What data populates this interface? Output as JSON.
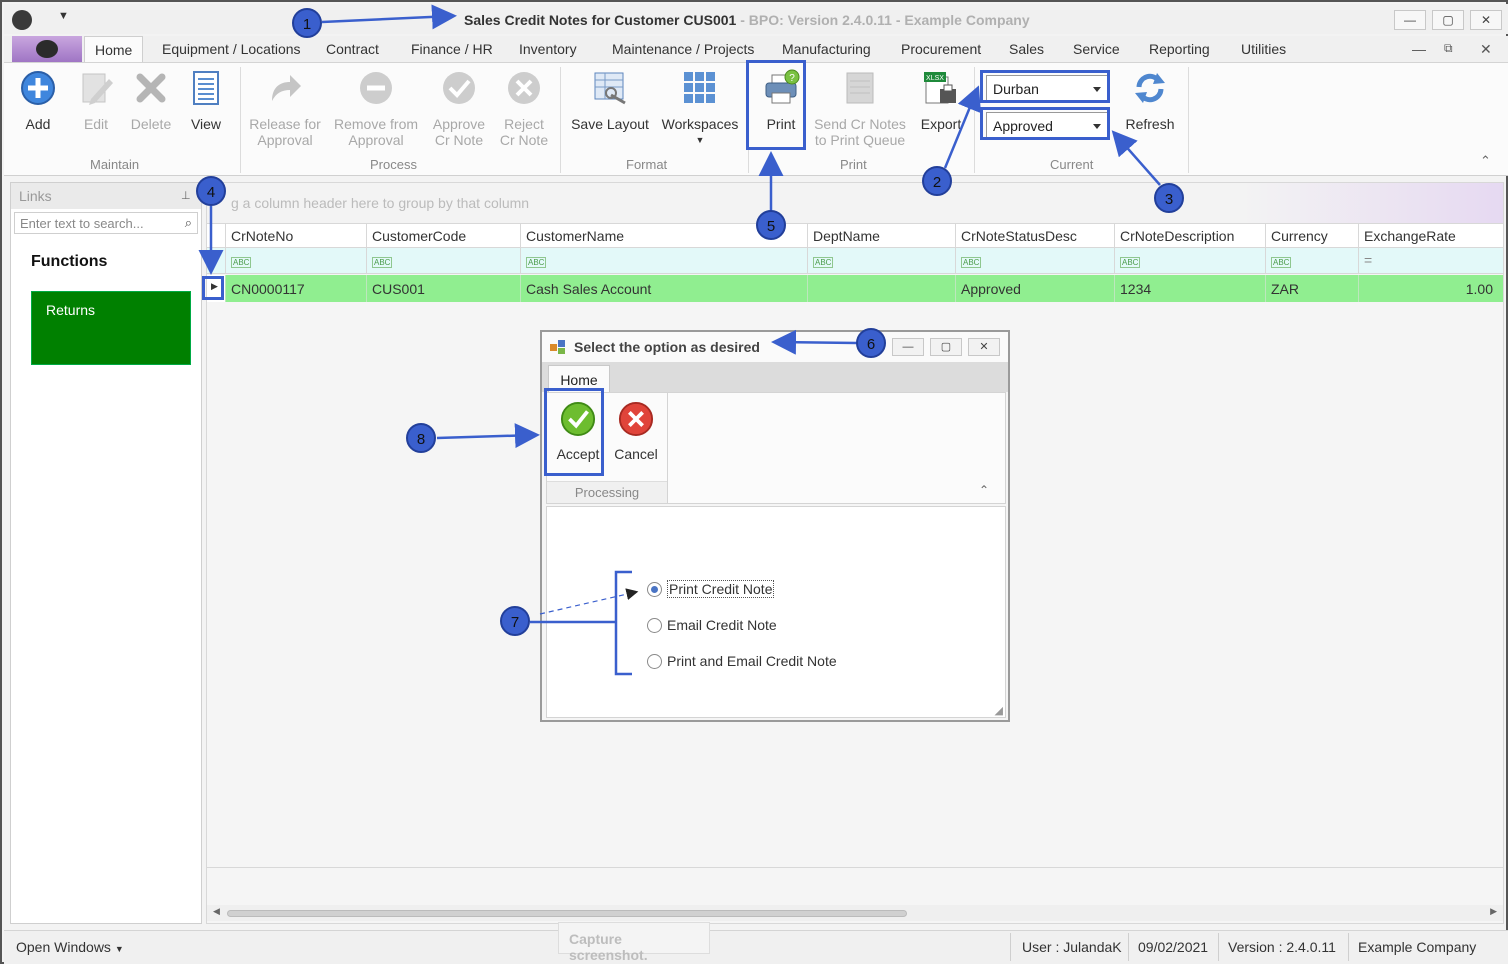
{
  "window": {
    "title": "Sales Credit Notes for Customer CUS001",
    "subtitle": "- BPO: Version 2.4.0.11 - Example Company"
  },
  "tabs": [
    "Home",
    "Equipment / Locations",
    "Contract",
    "Finance / HR",
    "Inventory",
    "Maintenance / Projects",
    "Manufacturing",
    "Procurement",
    "Sales",
    "Service",
    "Reporting",
    "Utilities"
  ],
  "ribbon": {
    "maintain": {
      "label": "Maintain",
      "add": "Add",
      "edit": "Edit",
      "delete": "Delete",
      "view": "View"
    },
    "process": {
      "label": "Process",
      "release_l1": "Release for",
      "release_l2": "Approval",
      "remove_l1": "Remove from",
      "remove_l2": "Approval",
      "approve_l1": "Approve",
      "approve_l2": "Cr Note",
      "reject_l1": "Reject",
      "reject_l2": "Cr Note"
    },
    "format": {
      "label": "Format",
      "save_layout": "Save Layout",
      "workspaces": "Workspaces"
    },
    "print": {
      "label": "Print",
      "print": "Print",
      "send_l1": "Send Cr Notes",
      "send_l2": "to Print Queue",
      "export": "Export"
    },
    "current": {
      "label": "Current",
      "site": "Durban",
      "status": "Approved",
      "refresh": "Refresh"
    }
  },
  "links": {
    "title": "Links",
    "search_placeholder": "Enter text to search...",
    "functions": "Functions",
    "returns": "Returns"
  },
  "grid": {
    "group_hint": "g a column header here to group by that column",
    "columns": [
      "CrNoteNo",
      "CustomerCode",
      "CustomerName",
      "DeptName",
      "CrNoteStatusDesc",
      "CrNoteDescription",
      "Currency",
      "ExchangeRate"
    ],
    "row": {
      "CrNoteNo": "CN0000117",
      "CustomerCode": "CUS001",
      "CustomerName": "Cash Sales Account",
      "DeptName": "",
      "CrNoteStatusDesc": "Approved",
      "CrNoteDescription": "1234",
      "Currency": "ZAR",
      "ExchangeRate": "1.00"
    }
  },
  "dialog": {
    "title": "Select the option as desired",
    "tab": "Home",
    "accept": "Accept",
    "cancel": "Cancel",
    "group": "Processing",
    "options": [
      "Print Credit Note",
      "Email Credit Note",
      "Print and Email Credit Note"
    ],
    "selected_option": "Print Credit Note"
  },
  "statusbar": {
    "open_windows": "Open Windows",
    "user": "User : JulandaK",
    "date": "09/02/2021",
    "version": "Version : 2.4.0.11",
    "company": "Example Company",
    "capture": "Capture screenshot."
  },
  "callouts": [
    "1",
    "2",
    "3",
    "4",
    "5",
    "6",
    "7",
    "8"
  ],
  "colors": {
    "accent": "#3a5fcd",
    "row_highlight": "#90ee90",
    "returns_tile": "#008000"
  }
}
